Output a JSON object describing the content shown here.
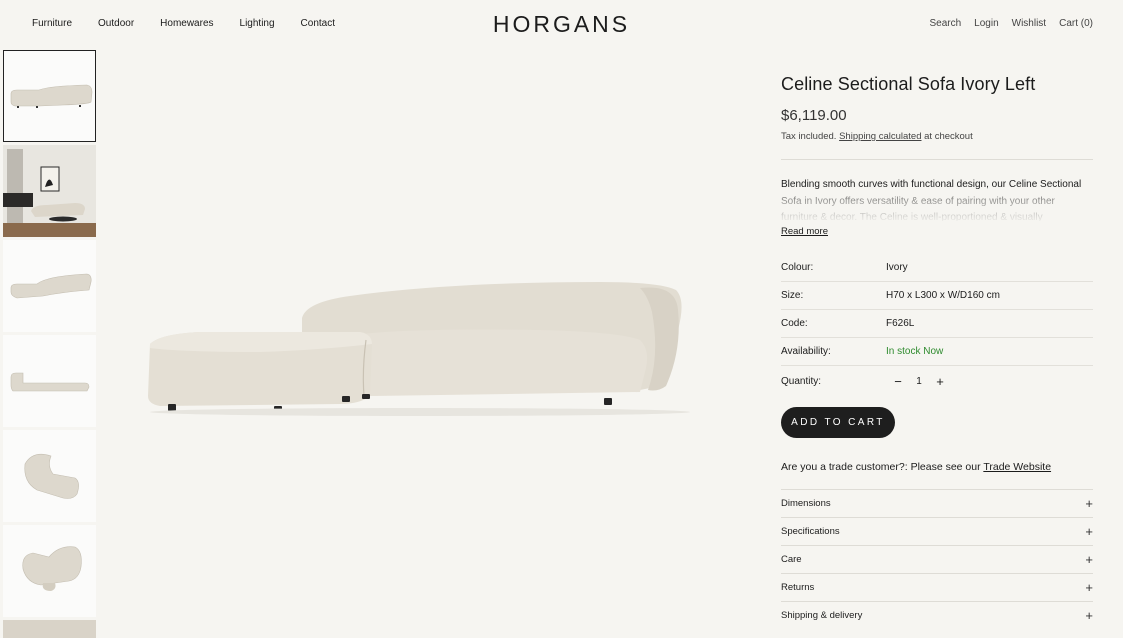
{
  "header": {
    "nav_left": [
      "Furniture",
      "Outdoor",
      "Homewares",
      "Lighting",
      "Contact"
    ],
    "logo": "HORGANS",
    "nav_right": [
      "Search",
      "Login",
      "Wishlist",
      "Cart (0)"
    ]
  },
  "product": {
    "title": "Celine Sectional Sofa Ivory Left",
    "price": "$6,119.00",
    "tax_prefix": "Tax included.",
    "tax_link": "Shipping calculated",
    "tax_suffix": "at checkout",
    "description": "Blending smooth curves with functional design, our Celine Sectional Sofa in Ivory offers versatility & ease of pairing with your other furniture & decor. The Celine is well-proportioned & visually",
    "read_more": "Read more",
    "specs": [
      {
        "label": "Colour:",
        "value": "Ivory"
      },
      {
        "label": "Size:",
        "value": "H70 x L300 x W/D160 cm"
      },
      {
        "label": "Code:",
        "value": "F626L"
      },
      {
        "label": "Availability:",
        "value": "In stock Now"
      }
    ],
    "quantity_label": "Quantity:",
    "quantity_value": "1",
    "add_to_cart": "ADD TO CART",
    "trade_text": "Are you a trade customer?: Please see our",
    "trade_link": "Trade Website",
    "accordions": [
      "Dimensions",
      "Specifications",
      "Care",
      "Returns",
      "Shipping & delivery"
    ]
  },
  "colors": {
    "background": "#f6f5f1",
    "button": "#1e1e1e",
    "in_stock": "#2e8b2e",
    "sofa": "#dcd7cc"
  },
  "icons": {
    "minus": "minus-icon",
    "plus": "plus-icon"
  }
}
